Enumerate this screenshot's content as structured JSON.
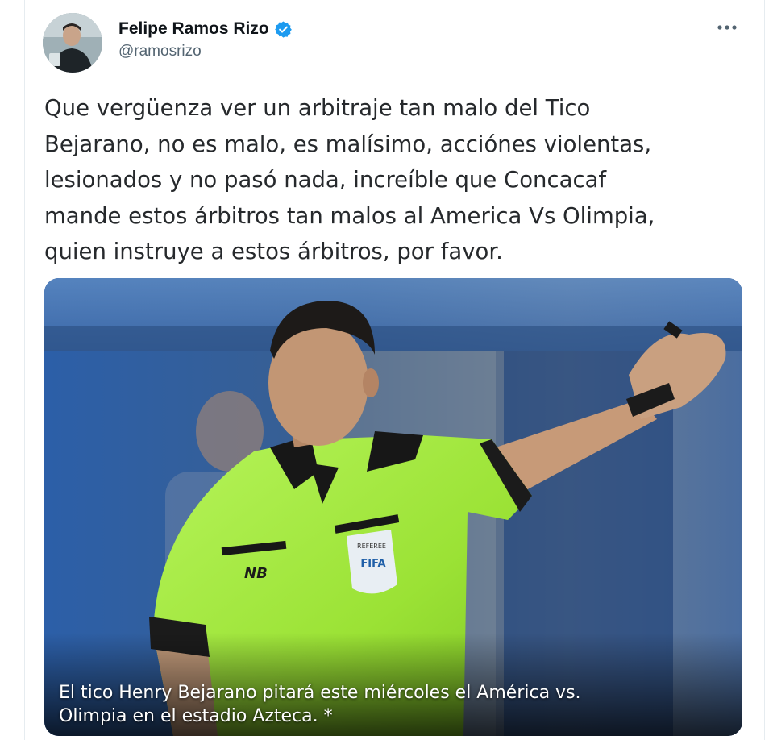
{
  "tweet": {
    "author": {
      "display_name": "Felipe Ramos Rizo",
      "handle": "@ramosrizo",
      "verified": true
    },
    "text": "Que vergüenza ver un arbitraje tan malo del Tico\nBejarano, no es malo, es malísimo, acciónes violentas,\nlesionados y no pasó nada, increíble que Concacaf\nmande estos árbitros tan malos al America Vs Olimpia,\nquien instruye a estos árbitros, por favor.",
    "media": {
      "caption": "El tico Henry Bejarano pitará este miércoles el América vs.\nOlimpia en el estadio Azteca. *",
      "badge_text_top": "REFEREE",
      "badge_text_main": "FIFA",
      "shirt_logo": "NB"
    }
  },
  "colors": {
    "verified": "#1d9bf0",
    "text": "#26292c",
    "handle": "#536471",
    "shirt": "#a8ee3e"
  },
  "icons": {
    "verified": "verified-badge-icon",
    "more": "more-options-icon"
  }
}
